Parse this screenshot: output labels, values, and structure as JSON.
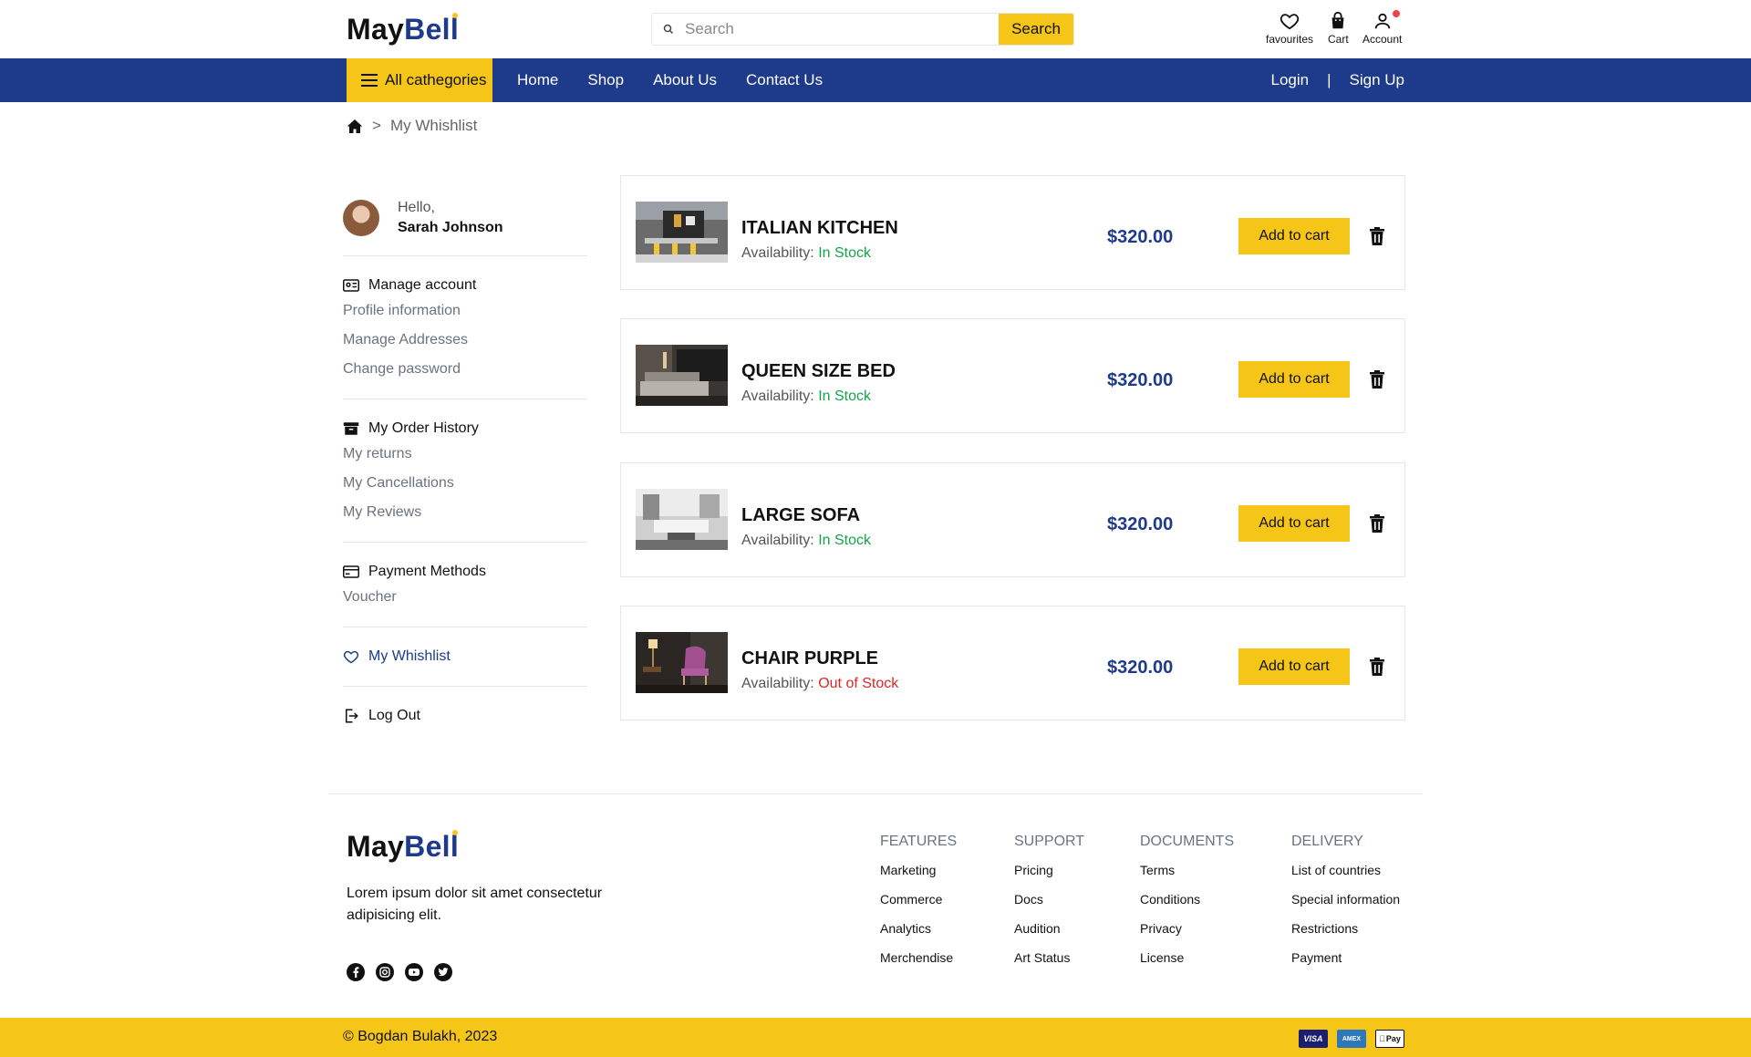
{
  "brand": {
    "name_part1": "May",
    "name_part2": "Bell"
  },
  "search": {
    "placeholder": "Search",
    "button_label": "Search"
  },
  "header_icons": {
    "favourites": "favourites",
    "cart": "Cart",
    "account": "Account"
  },
  "nav": {
    "all_categories": "All cathegories",
    "links": [
      "Home",
      "Shop",
      "About Us",
      "Contact Us"
    ],
    "login": "Login",
    "divider": "|",
    "signup": "Sign Up"
  },
  "breadcrumb": {
    "separator": ">",
    "current": "My Whishlist"
  },
  "sidebar": {
    "greeting": "Hello,",
    "user_name": "Sarah Johnson",
    "manage_account": {
      "title": "Manage account",
      "items": [
        "Profile information",
        "Manage Addresses",
        "Change password"
      ]
    },
    "order_history": {
      "title": "My Order History",
      "items": [
        "My returns",
        "My Cancellations",
        "My Reviews"
      ]
    },
    "payment_methods": {
      "title": "Payment Methods",
      "items": [
        "Voucher"
      ]
    },
    "wishlist": "My Whishlist",
    "logout": "Log Out"
  },
  "wishlist": {
    "availability_label": "Availability:",
    "add_to_cart_label": "Add to cart",
    "items": [
      {
        "title": "ITALIAN KITCHEN",
        "availability": "In Stock",
        "in_stock": true,
        "price": "$320.00"
      },
      {
        "title": "QUEEN SIZE BED",
        "availability": "In Stock",
        "in_stock": true,
        "price": "$320.00"
      },
      {
        "title": "LARGE SOFA",
        "availability": "In Stock",
        "in_stock": true,
        "price": "$320.00"
      },
      {
        "title": "CHAIR PURPLE",
        "availability": "Out of Stock",
        "in_stock": false,
        "price": "$320.00"
      }
    ]
  },
  "footer": {
    "description": "Lorem ipsum dolor sit amet consectetur adipisicing elit.",
    "columns": [
      {
        "title": "FEATURES",
        "links": [
          "Marketing",
          "Commerce",
          "Analytics",
          "Merchendise"
        ]
      },
      {
        "title": "SUPPORT",
        "links": [
          "Pricing",
          "Docs",
          "Audition",
          "Art Status"
        ]
      },
      {
        "title": "DOCUMENTS",
        "links": [
          "Terms",
          "Conditions",
          "Privacy",
          "License"
        ]
      },
      {
        "title": "DELIVERY",
        "links": [
          "List of countries",
          "Special information",
          "Restrictions",
          "Payment"
        ]
      }
    ],
    "copyright": "© Bogdan Bulakh, 2023",
    "payment_icons": {
      "visa": "VISA",
      "amex": "AMEX",
      "applepay": "Pay"
    }
  },
  "colors": {
    "brand_blue": "#1e3a8a",
    "accent_yellow": "#f5c518",
    "in_stock": "#16a34a",
    "out_of_stock": "#dc2626"
  }
}
